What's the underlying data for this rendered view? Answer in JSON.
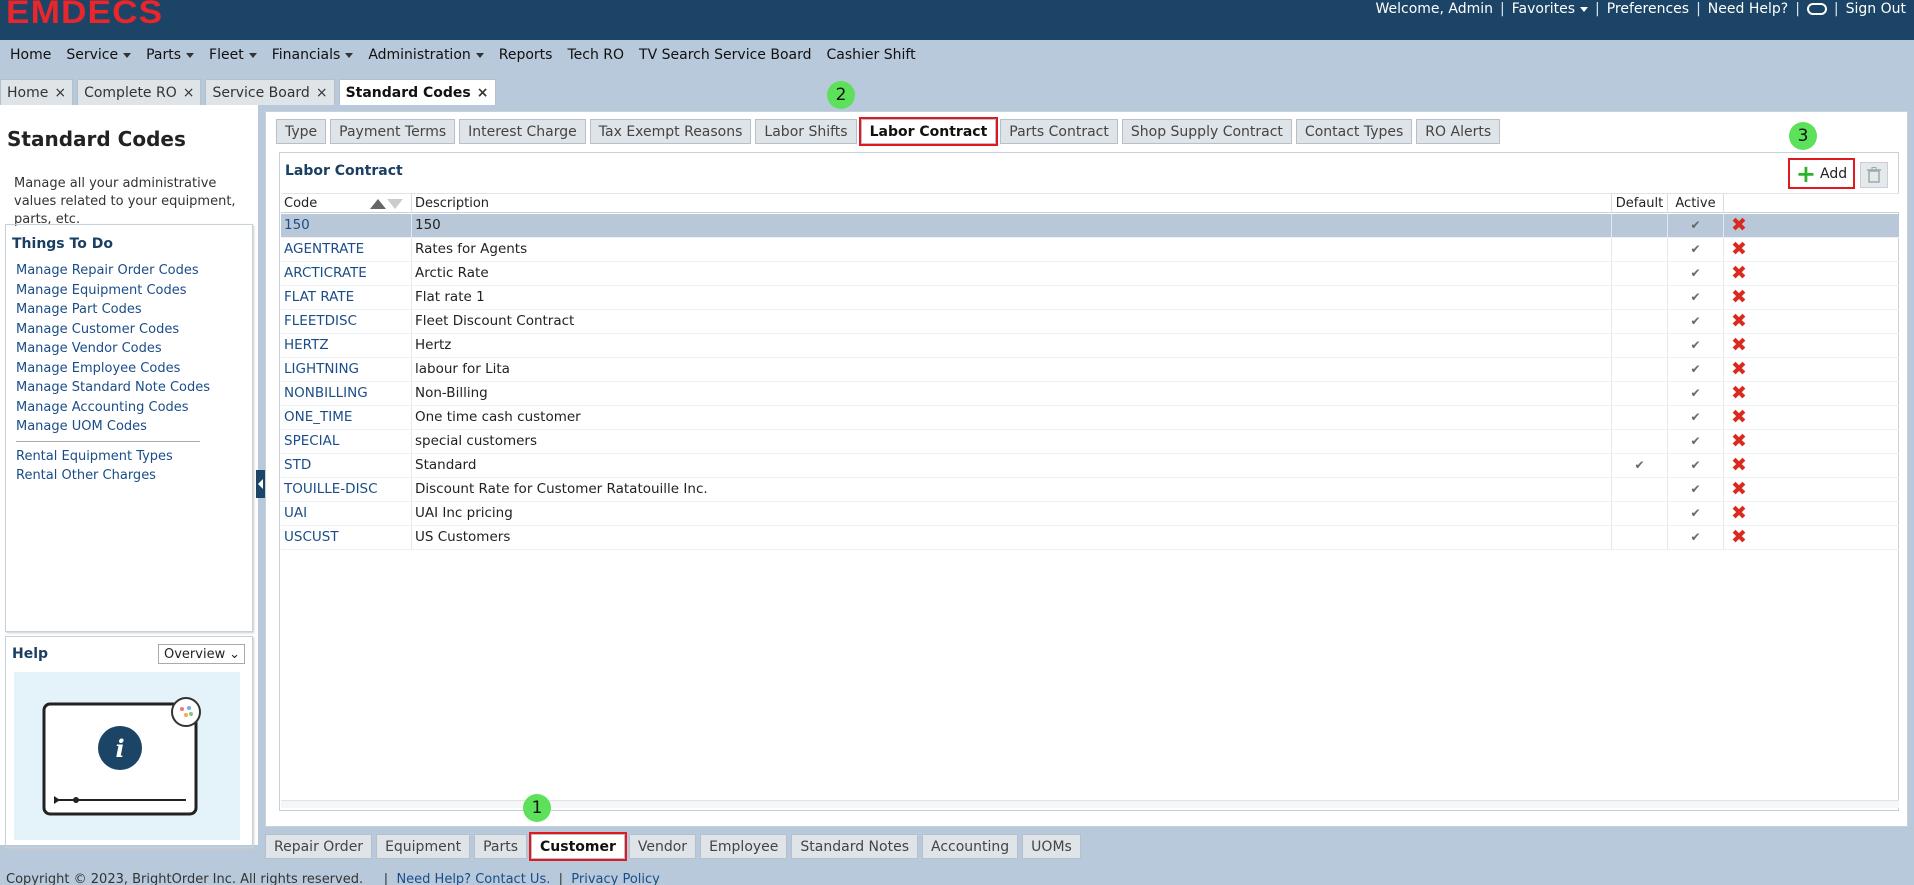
{
  "app": {
    "logo": "EMDECS",
    "welcome": "Welcome, Admin",
    "favorites": "Favorites",
    "preferences": "Preferences",
    "need_help": "Need Help?",
    "sign_out": "Sign Out"
  },
  "nav": [
    "Home",
    "Service",
    "Parts",
    "Fleet",
    "Financials",
    "Administration",
    "Reports",
    "Tech RO",
    "TV Search Service Board",
    "Cashier Shift"
  ],
  "page_tabs": [
    "Home",
    "Complete RO",
    "Service Board",
    "Standard Codes"
  ],
  "left": {
    "title": "Standard Codes",
    "description": "Manage all your administrative values related to your equipment, parts, etc.",
    "todo_title": "Things To Do",
    "todo_links": [
      "Manage Repair Order Codes",
      "Manage Equipment Codes",
      "Manage Part Codes",
      "Manage Customer Codes",
      "Manage Vendor Codes",
      "Manage Employee Codes",
      "Manage Standard Note Codes",
      "Manage Accounting Codes",
      "Manage UOM Codes"
    ],
    "rental_links": [
      "Rental Equipment Types",
      "Rental Other Charges"
    ],
    "help_title": "Help",
    "help_select": "Overview"
  },
  "sub_tabs": [
    "Type",
    "Payment Terms",
    "Interest Charge",
    "Tax Exempt Reasons",
    "Labor Shifts",
    "Labor Contract",
    "Parts Contract",
    "Shop Supply Contract",
    "Contact Types",
    "RO Alerts"
  ],
  "grid": {
    "title": "Labor Contract",
    "add_label": "Add",
    "headers": {
      "code": "Code",
      "description": "Description",
      "default": "Default",
      "active": "Active"
    },
    "rows": [
      {
        "code": "150",
        "description": "150",
        "default": "",
        "active": "✔"
      },
      {
        "code": "AGENTRATE",
        "description": "Rates for Agents",
        "default": "",
        "active": "✔"
      },
      {
        "code": "ARCTICRATE",
        "description": "Arctic Rate",
        "default": "",
        "active": "✔"
      },
      {
        "code": "FLAT RATE",
        "description": "Flat rate 1",
        "default": "",
        "active": "✔"
      },
      {
        "code": "FLEETDISC",
        "description": "Fleet Discount Contract",
        "default": "",
        "active": "✔"
      },
      {
        "code": "HERTZ",
        "description": "Hertz",
        "default": "",
        "active": "✔"
      },
      {
        "code": "LIGHTNING",
        "description": "labour for Lita",
        "default": "",
        "active": "✔"
      },
      {
        "code": "NONBILLING",
        "description": "Non-Billing",
        "default": "",
        "active": "✔"
      },
      {
        "code": "ONE_TIME",
        "description": "One time cash customer",
        "default": "",
        "active": "✔"
      },
      {
        "code": "SPECIAL",
        "description": "special customers",
        "default": "",
        "active": "✔"
      },
      {
        "code": "STD",
        "description": "Standard",
        "default": "✔",
        "active": "✔"
      },
      {
        "code": "TOUILLE-DISC",
        "description": "Discount Rate for Customer Ratatouille Inc.",
        "default": "",
        "active": "✔"
      },
      {
        "code": "UAI",
        "description": "UAI Inc pricing",
        "default": "",
        "active": "✔"
      },
      {
        "code": "USCUST",
        "description": "US Customers",
        "default": "",
        "active": "✔"
      }
    ]
  },
  "bottom_tabs": [
    "Repair Order",
    "Equipment",
    "Parts",
    "Customer",
    "Vendor",
    "Employee",
    "Standard Notes",
    "Accounting",
    "UOMs"
  ],
  "footer": {
    "copyright": "Copyright © 2023, BrightOrder Inc. All rights reserved.",
    "help_link": "Need Help? Contact Us.",
    "privacy": "Privacy Policy"
  },
  "steps": [
    "1",
    "2",
    "3"
  ],
  "colors": {
    "topbar": "#1b4466",
    "logo": "#e8262b",
    "highlight": "#e0191f",
    "step": "#5de05a"
  }
}
